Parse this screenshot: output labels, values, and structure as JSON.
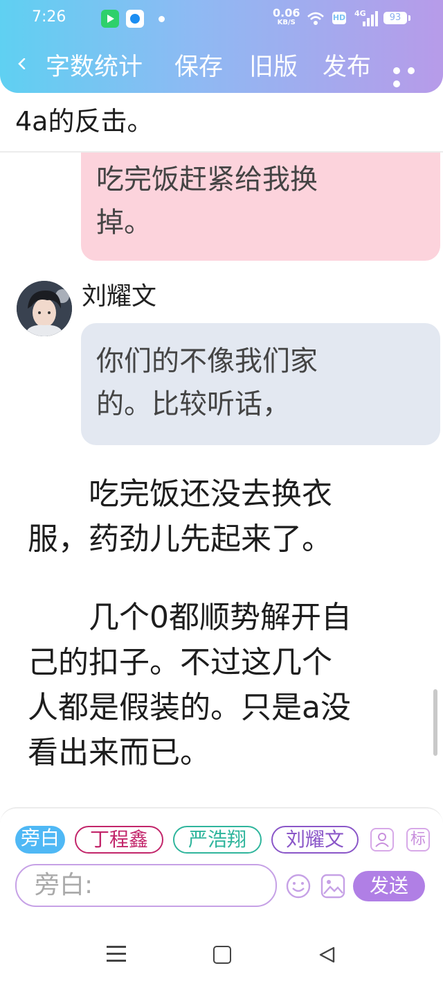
{
  "status_bar": {
    "time": "7:26",
    "net_speed": "0.06",
    "net_unit": "KB/S",
    "hd": "HD",
    "network": "4G",
    "battery": "93"
  },
  "toolbar": {
    "back_icon": "chevron-left-icon",
    "items": [
      "字数统计",
      "保存",
      "旧版",
      "发布"
    ],
    "more_icon": "more-dots-icon"
  },
  "content": {
    "top_line": "4a的反击。",
    "pink_bubble": {
      "lines": [
        "吃完饭赶紧给我换",
        "掉。"
      ]
    },
    "speaker": {
      "name": "刘耀文",
      "bubble_lines": [
        "你们的不像我们家",
        "的。比较听话，"
      ]
    },
    "paragraph1": [
      "吃完饭还没去换衣",
      "服，药劲儿先起来了。"
    ],
    "paragraph2": [
      "几个0都顺势解开自",
      "己的扣子。不过这几个",
      "人都是假装的。只是a没",
      "看出来而已。"
    ]
  },
  "composer": {
    "roles": [
      "旁白",
      "丁程鑫",
      "严浩翔",
      "刘耀文"
    ],
    "role_icon_label": "标",
    "input_placeholder": "旁白:",
    "send_label": "发送"
  },
  "colors": {
    "header_gradient_start": "#5fd0f2",
    "header_gradient_end": "#b79be9",
    "pink_bubble": "#fcd3dc",
    "gray_bubble": "#e3e8f1",
    "send_button": "#b07fe5"
  }
}
